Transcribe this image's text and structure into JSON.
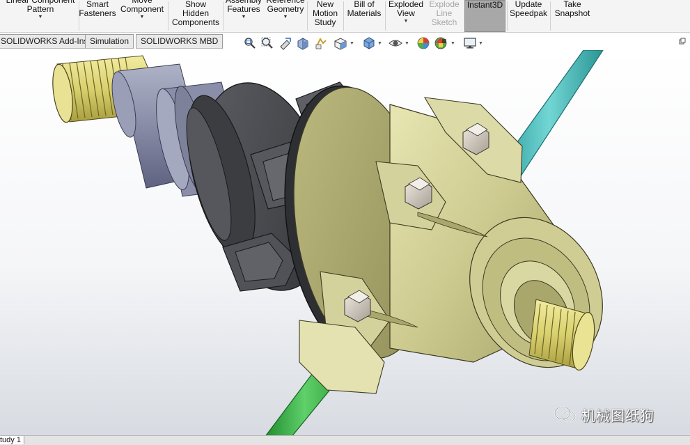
{
  "ribbon": {
    "buttons": [
      {
        "id": "linear-component-pattern",
        "label": "Linear Component\nPattern",
        "caret": true
      },
      {
        "id": "smart-fasteners",
        "label": "Smart\nFasteners",
        "caret": false
      },
      {
        "id": "move-component",
        "label": "Move\nComponent",
        "caret": true
      },
      {
        "id": "show-hidden-components",
        "label": "Show\nHidden\nComponents",
        "caret": false
      },
      {
        "id": "assembly-features",
        "label": "Assembly\nFeatures",
        "caret": true
      },
      {
        "id": "reference-geometry",
        "label": "Reference\nGeometry",
        "caret": true
      },
      {
        "id": "new-motion-study",
        "label": "New\nMotion\nStudy",
        "caret": false
      },
      {
        "id": "bill-of-materials",
        "label": "Bill of\nMaterials",
        "caret": false
      },
      {
        "id": "exploded-view",
        "label": "Exploded\nView",
        "caret": true
      },
      {
        "id": "explode-line-sketch",
        "label": "Explode\nLine\nSketch",
        "caret": false,
        "disabled": true
      },
      {
        "id": "instant3d",
        "label": "Instant3D",
        "caret": false,
        "active": true
      },
      {
        "id": "update-speedpak",
        "label": "Update\nSpeedpak",
        "caret": false
      },
      {
        "id": "take-snapshot",
        "label": "Take\nSnapshot",
        "caret": false
      }
    ]
  },
  "tabs": [
    "SOLIDWORKS Add-Ins",
    "Simulation",
    "SOLIDWORKS MBD"
  ],
  "heads_up_toolbar": [
    "zoom-to-fit-icon",
    "zoom-to-area-icon",
    "previous-view-icon",
    "section-view-icon",
    "dynamic-annotation-views-icon",
    "view-orientation-icon",
    "display-style-icon",
    "hide-show-items-icon",
    "edit-appearance-icon",
    "apply-scene-icon",
    "view-settings-icon"
  ],
  "watermark": {
    "text": "机械图纸狗"
  },
  "bottom_tab": {
    "label": "tudy 1"
  },
  "colors": {
    "shaft_green": "#3fb84f",
    "shaft_teal": "#3fbcbc",
    "housing_khaki": "#cfcd94",
    "coupling_dark": "#4a4c50",
    "shaft_blue_grey": "#8e92ab",
    "spline_yellow": "#e6df8a",
    "active_button": "#a8a8a8"
  }
}
